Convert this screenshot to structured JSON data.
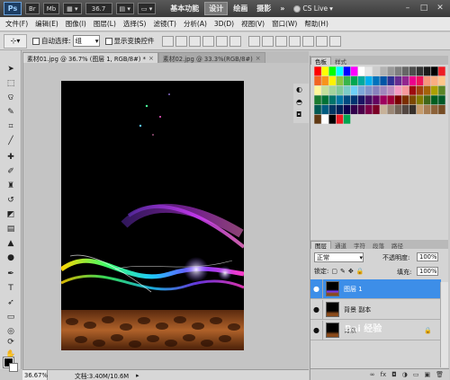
{
  "titlebar": {
    "logo": "Ps",
    "br_label": "Br",
    "mb_label": "Mb",
    "zoom": "36.7",
    "workspaces": [
      "基本功能",
      "设计",
      "绘画",
      "摄影"
    ],
    "active_workspace": "设计",
    "more": "»",
    "cslive": "CS Live",
    "minimize": "–",
    "maximize": "□",
    "close": "✕"
  },
  "menu": [
    "文件(F)",
    "编辑(E)",
    "图像(I)",
    "图层(L)",
    "选择(S)",
    "滤镜(T)",
    "分析(A)",
    "3D(D)",
    "视图(V)",
    "窗口(W)",
    "帮助(H)"
  ],
  "options": {
    "tool_icon": "⊹",
    "auto_select_label": "自动选择:",
    "auto_select_value": "组",
    "show_transform_label": "显示变换控件"
  },
  "doc_tabs": [
    {
      "label": "素材01.jpg @ 36.7% (图层 1, RGB/8#) *",
      "close": "×"
    },
    {
      "label": "素材02.jpg @ 33.3%(RGB/8#)",
      "close": "×"
    }
  ],
  "status": {
    "zoom": "36.67%",
    "doc_size": "文档:3.40M/10.6M",
    "arrow": "▸"
  },
  "swatches_panel": {
    "tabs": [
      "色板",
      "样式"
    ],
    "colors": [
      "#ff0000",
      "#ffff00",
      "#00ff00",
      "#00ffff",
      "#0000ff",
      "#ff00ff",
      "#ffffff",
      "#e6e6e6",
      "#cccccc",
      "#b3b3b3",
      "#999999",
      "#808080",
      "#666666",
      "#4d4d4d",
      "#333333",
      "#1a1a1a",
      "#000000",
      "#ed1c24",
      "#f26522",
      "#f7941d",
      "#fff200",
      "#8dc63f",
      "#39b54a",
      "#00a651",
      "#00a99d",
      "#00aeef",
      "#0072bc",
      "#0054a6",
      "#2e3192",
      "#662d91",
      "#92278f",
      "#ec008c",
      "#ed145b",
      "#f7977a",
      "#f9ad81",
      "#fdc68a",
      "#fff79a",
      "#c4df9b",
      "#a3d39c",
      "#82ca9c",
      "#7accc8",
      "#6dcff6",
      "#7da7d9",
      "#8393ca",
      "#8781bd",
      "#a186be",
      "#bd8cbf",
      "#f49ac2",
      "#f6989d",
      "#9e0b0f",
      "#a0410d",
      "#a36209",
      "#aba000",
      "#598527",
      "#1a7b30",
      "#007236",
      "#00746b",
      "#0076a3",
      "#004a80",
      "#003471",
      "#1b1464",
      "#440e62",
      "#630460",
      "#9e005d",
      "#9e0039",
      "#790000",
      "#7b2e00",
      "#7d4900",
      "#827b00",
      "#406618",
      "#005e20",
      "#005826",
      "#005952",
      "#005b7f",
      "#003663",
      "#002157",
      "#0d004c",
      "#32004b",
      "#4b0049",
      "#7b0046",
      "#7a0026",
      "#c7b299",
      "#998675",
      "#736357",
      "#534741",
      "#37302a",
      "#c69c6d",
      "#a67c52",
      "#8c6239",
      "#754c24",
      "#603913",
      "#ffffff",
      "#000000",
      "#ed1c24",
      "#00a651"
    ]
  },
  "layers_panel": {
    "tabs": [
      "图层",
      "通道",
      "字符",
      "段落",
      "路径"
    ],
    "blend_mode": "正常",
    "opacity_label": "不透明度:",
    "opacity": "100%",
    "lock_label": "锁定:",
    "fill_label": "填充:",
    "fill": "100%",
    "layers": [
      {
        "name": "图层 1",
        "selected": true,
        "eye": "●",
        "lock": ""
      },
      {
        "name": "背景 副本",
        "selected": false,
        "eye": "●",
        "lock": ""
      },
      {
        "name": "背景",
        "selected": false,
        "eye": "●",
        "lock": "🔒"
      }
    ],
    "bottom_icons": [
      "∞",
      "fx",
      "◘",
      "◑",
      "▭",
      "▣",
      "🗑"
    ]
  },
  "watermark": "Bai 经验",
  "colors": {
    "selected_layer": "#3d8ee8",
    "title_bg": "#3a3a3a"
  }
}
